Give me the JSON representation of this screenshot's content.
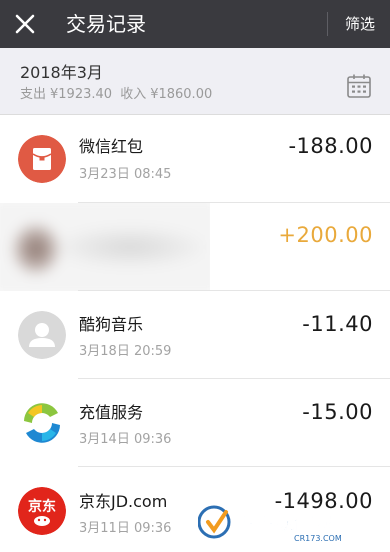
{
  "header": {
    "title": "交易记录",
    "filter_label": "筛选",
    "close_icon": "close-icon"
  },
  "month_section": {
    "month": "2018年3月",
    "expense_label": "支出",
    "expense_amount": "¥1923.40",
    "income_label": "收入",
    "income_amount": "¥1860.00",
    "calendar_icon": "calendar-icon"
  },
  "transactions": [
    {
      "name": "微信红包",
      "time": "3月23日 08:45",
      "amount": "-188.00",
      "icon": "red-packet-icon",
      "accent": "#e05a44"
    },
    {
      "name": "",
      "time": "",
      "amount": "+200.00",
      "icon": "blurred-avatar",
      "accent": "#e9a93b"
    },
    {
      "name": "酷狗音乐",
      "time": "3月18日 20:59",
      "amount": "-11.40",
      "icon": "default-avatar-icon",
      "accent": "#d9d9d9"
    },
    {
      "name": "充值服务",
      "time": "3月14日 09:36",
      "amount": "-15.00",
      "icon": "recharge-service-icon",
      "accent": "#2f8fd0"
    },
    {
      "name": "京东JD.com",
      "time": "3月11日 09:36",
      "amount": "-1498.00",
      "icon": "jd-logo-icon",
      "accent": "#e1251b"
    }
  ],
  "watermark": {
    "text": "西西软件园",
    "url": "CR173.COM"
  },
  "colors": {
    "topbar": "#3a3a3f",
    "header_bg": "#efeff4",
    "income": "#e9a93b"
  }
}
